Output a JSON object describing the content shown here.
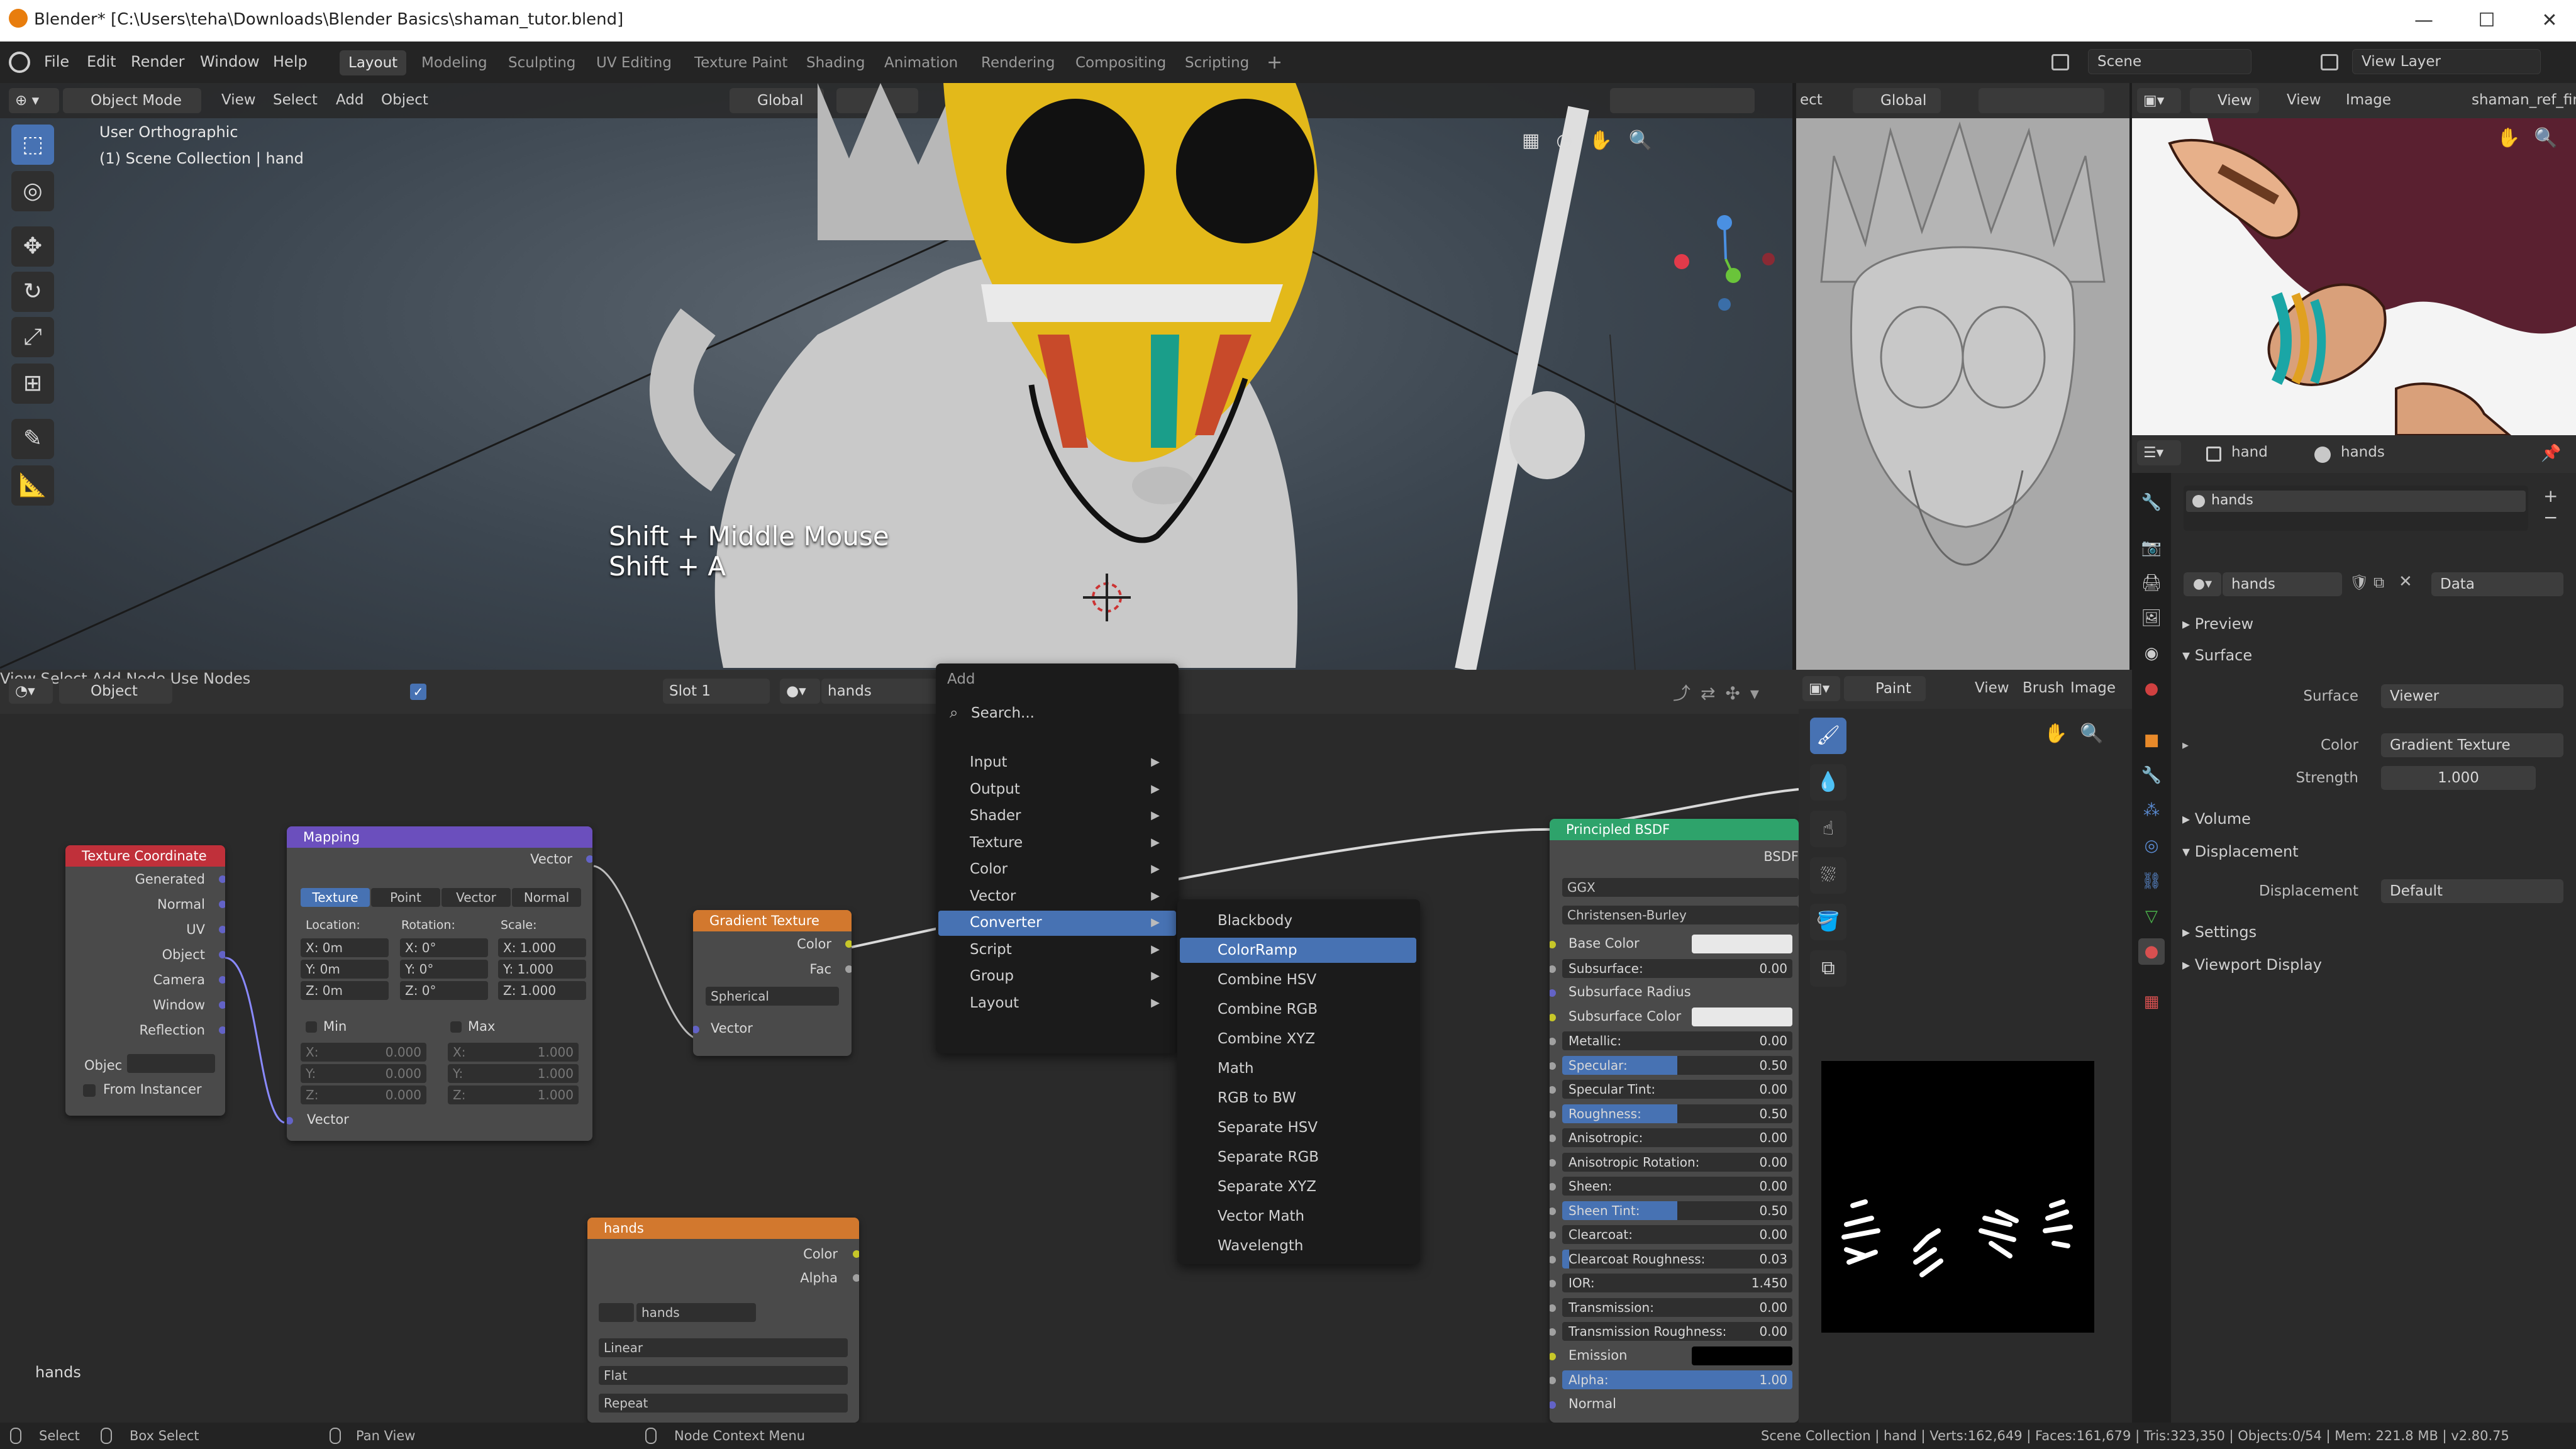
{
  "window": {
    "title": "Blender* [C:\\Users\\teha\\Downloads\\Blender Basics\\shaman_tutor.blend]",
    "controls": [
      "—",
      "☐",
      "✕"
    ]
  },
  "topbar": {
    "menus": [
      "File",
      "Edit",
      "Render",
      "Window",
      "Help"
    ],
    "workspaces": [
      "Layout",
      "Modeling",
      "Sculpting",
      "UV Editing",
      "Texture Paint",
      "Shading",
      "Animation",
      "Rendering",
      "Compositing",
      "Scripting"
    ],
    "active_workspace": "Layout",
    "add_workspace": "+",
    "scene": "Scene",
    "view_layer": "View Layer"
  },
  "viewport": {
    "mode": "Object Mode",
    "menus": [
      "View",
      "Select",
      "Add",
      "Object"
    ],
    "orientation": "Global",
    "view_name": "User Orthographic",
    "collection": "(1) Scene Collection | hand",
    "shortcut_line1": "Shift + Middle Mouse",
    "shortcut_line2": "Shift + A"
  },
  "viewport2": {
    "left_label": "ect",
    "orientation": "Global"
  },
  "image_viewer": {
    "menus": [
      "View",
      "View",
      "Image"
    ],
    "image_name": "shaman_ref_fin"
  },
  "properties": {
    "object": "hand",
    "material": "hands",
    "slot": "hands",
    "material_field": "hands",
    "data_dropdown": "Data",
    "sections": {
      "preview": "Preview",
      "surface": "Surface",
      "volume": "Volume",
      "displacement": "Displacement",
      "settings": "Settings",
      "viewport_display": "Viewport Display"
    },
    "surface_label": "Surface",
    "surface_value": "Viewer",
    "color_label": "Color",
    "color_value": "Gradient Texture",
    "strength_label": "Strength",
    "strength_value": "1.000",
    "displacement_label": "Displacement",
    "displacement_value": "Default"
  },
  "node_header": {
    "editor": "Object",
    "menus": [
      "View",
      "Select",
      "Add",
      "Node"
    ],
    "use_nodes": "Use Nodes",
    "slot": "Slot 1",
    "material": "hands"
  },
  "nodes": {
    "texcoord": {
      "title": "Texture Coordinate",
      "outputs": [
        "Generated",
        "Normal",
        "UV",
        "Object",
        "Camera",
        "Window",
        "Reflection"
      ],
      "object_label": "Objec",
      "from_instancer": "From Instancer"
    },
    "mapping": {
      "title": "Mapping",
      "output": "Vector",
      "tabs": [
        "Texture",
        "Point",
        "Vector",
        "Normal"
      ],
      "col_location": "Location:",
      "col_rotation": "Rotation:",
      "col_scale": "Scale:",
      "loc": [
        "X:  0m",
        "Y:  0m",
        "Z:  0m"
      ],
      "rot": [
        "X:   0°",
        "Y:   0°",
        "Z:   0°"
      ],
      "scale": [
        "X: 1.000",
        "Y: 1.000",
        "Z: 1.000"
      ],
      "min": "Min",
      "max": "Max",
      "min_vals": [
        "0.000",
        "0.000",
        "0.000"
      ],
      "max_vals": [
        "1.000",
        "1.000",
        "1.000"
      ],
      "min_axes": [
        "X:",
        "Y:",
        "Z:"
      ],
      "input": "Vector"
    },
    "gradient": {
      "title": "Gradient Texture",
      "outputs": [
        "Color",
        "Fac"
      ],
      "type": "Spherical",
      "input": "Vector"
    },
    "image": {
      "title": "hands",
      "outputs": [
        "Color",
        "Alpha"
      ],
      "image_name": "hands",
      "interpolation": "Linear",
      "projection": "Flat",
      "extension": "Repeat"
    },
    "bsdf": {
      "title": "Principled BSDF",
      "output": "BSDF",
      "distribution": "GGX",
      "subsurface_method": "Christensen-Burley",
      "rows": [
        {
          "label": "Base Color",
          "kind": "color",
          "color": "#e8e8e8"
        },
        {
          "label": "Subsurface:",
          "value": "0.00",
          "fill": 0
        },
        {
          "label": "Subsurface Radius",
          "kind": "plain"
        },
        {
          "label": "Subsurface Color",
          "kind": "color",
          "color": "#e8e8e8"
        },
        {
          "label": "Metallic:",
          "value": "0.00",
          "fill": 0
        },
        {
          "label": "Specular:",
          "value": "0.50",
          "fill": 0.5
        },
        {
          "label": "Specular Tint:",
          "value": "0.00",
          "fill": 0
        },
        {
          "label": "Roughness:",
          "value": "0.50",
          "fill": 0.5
        },
        {
          "label": "Anisotropic:",
          "value": "0.00",
          "fill": 0
        },
        {
          "label": "Anisotropic Rotation:",
          "value": "0.00",
          "fill": 0
        },
        {
          "label": "Sheen:",
          "value": "0.00",
          "fill": 0
        },
        {
          "label": "Sheen Tint:",
          "value": "0.50",
          "fill": 0.5
        },
        {
          "label": "Clearcoat:",
          "value": "0.00",
          "fill": 0
        },
        {
          "label": "Clearcoat Roughness:",
          "value": "0.03",
          "fill": 0.03
        },
        {
          "label": "IOR:",
          "value": "1.450",
          "fill": 0
        },
        {
          "label": "Transmission:",
          "value": "0.00",
          "fill": 0
        },
        {
          "label": "Transmission Roughness:",
          "value": "0.00",
          "fill": 0
        },
        {
          "label": "Emission",
          "kind": "color",
          "color": "#000000"
        },
        {
          "label": "Alpha:",
          "value": "1.00",
          "fill": 1
        },
        {
          "label": "Normal",
          "kind": "plain"
        }
      ]
    }
  },
  "add_menu": {
    "title": "Add",
    "search": "Search...",
    "items": [
      "Input",
      "Output",
      "Shader",
      "Texture",
      "Color",
      "Vector",
      "Converter",
      "Script",
      "Group",
      "Layout"
    ],
    "active": "Converter"
  },
  "converter_menu": {
    "items": [
      "Blackbody",
      "ColorRamp",
      "Combine HSV",
      "Combine RGB",
      "Combine XYZ",
      "Math",
      "RGB to BW",
      "Separate HSV",
      "Separate RGB",
      "Separate XYZ",
      "Vector Math",
      "Wavelength"
    ],
    "active": "ColorRamp"
  },
  "paint_editor": {
    "mode": "Paint",
    "menus": [
      "View",
      "Brush",
      "Image"
    ]
  },
  "node_editor_label": "hands",
  "status": {
    "select": "Select",
    "box_select": "Box Select",
    "pan_view": "Pan View",
    "context_menu": "Node Context Menu",
    "stats": "Scene Collection | hand | Verts:162,649 | Faces:161,679 | Tris:323,350 | Objects:0/54 | Mem: 221.8 MB | v2.80.75"
  },
  "colors": {
    "accent": "#4772b3",
    "texcoord_header": "#c0303a",
    "mapping_header": "#6b4fbd",
    "texture_header": "#d2782e",
    "shader_header": "#2ea36b",
    "socket_vector": "#6363c7",
    "socket_color": "#c7c729",
    "socket_float": "#a1a1a1"
  }
}
